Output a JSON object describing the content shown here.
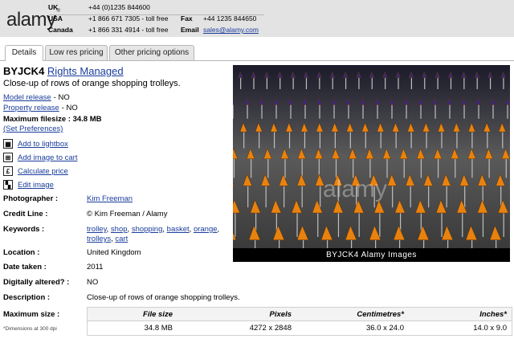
{
  "header": {
    "logo": "alamy",
    "contacts": [
      {
        "region": "UK",
        "number": "+44 (0)1235 844600",
        "label2": "",
        "value2": ""
      },
      {
        "region": "USA",
        "number": "+1 866 671 7305 - toll free",
        "label2": "Fax",
        "value2": "+44 1235 844650"
      },
      {
        "region": "Canada",
        "number": "+1 866 331 4914 - toll free",
        "label2": "Email",
        "value2": "sales@alamy.com"
      }
    ]
  },
  "tabs": [
    "Details",
    "Low res pricing",
    "Other pricing options"
  ],
  "image": {
    "id": "BYJCK4",
    "license": "Rights Managed",
    "description": "Close-up of rows of orange shopping trolleys.",
    "model_release_label": "Model release",
    "model_release_value": "- NO",
    "property_release_label": "Property release",
    "property_release_value": "- NO",
    "max_filesize": "Maximum filesize : 34.8 MB",
    "set_preferences": "(Set Preferences)",
    "caption": "BYJCK4  Alamy Images",
    "watermark": "alamy"
  },
  "actions": [
    {
      "label": "Add to lightbox",
      "icon": "lightbox-icon",
      "glyph": "▦"
    },
    {
      "label": "Add image to cart",
      "icon": "cart-icon",
      "glyph": "⊞"
    },
    {
      "label": "Calculate price",
      "icon": "pound-icon",
      "glyph": "£"
    },
    {
      "label": "Edit image",
      "icon": "edit-image-icon",
      "glyph": "▚"
    }
  ],
  "meta": {
    "photographer_label": "Photographer :",
    "photographer": "Kim Freeman",
    "credit_label": "Credit Line :",
    "credit": "© Kim Freeman / Alamy",
    "keywords_label": "Keywords :",
    "keywords": [
      "trolley",
      "shop",
      "shopping",
      "basket",
      "orange",
      "trolleys",
      "cart"
    ],
    "location_label": "Location :",
    "location": "United Kingdom",
    "date_label": "Date taken :",
    "date": "2011",
    "altered_label": "Digitally altered? :",
    "altered": "NO",
    "description_label": "Description :",
    "description": "Close-up of rows of orange shopping trolleys."
  },
  "size_table": {
    "label": "Maximum size :",
    "note": "*Dimensions at 300 dpi",
    "headers": [
      "File size",
      "Pixels",
      "Centimetres*",
      "Inches*"
    ],
    "values": [
      "34.8 MB",
      "4272 x 2848",
      "36.0 x 24.0",
      "14.0 x 9.0"
    ]
  },
  "colors": {
    "link": "#1a3d9c",
    "header_bg": "#e3e3e3",
    "trolley_orange": "#e8820f",
    "trolley_purple": "#3a2a70"
  }
}
